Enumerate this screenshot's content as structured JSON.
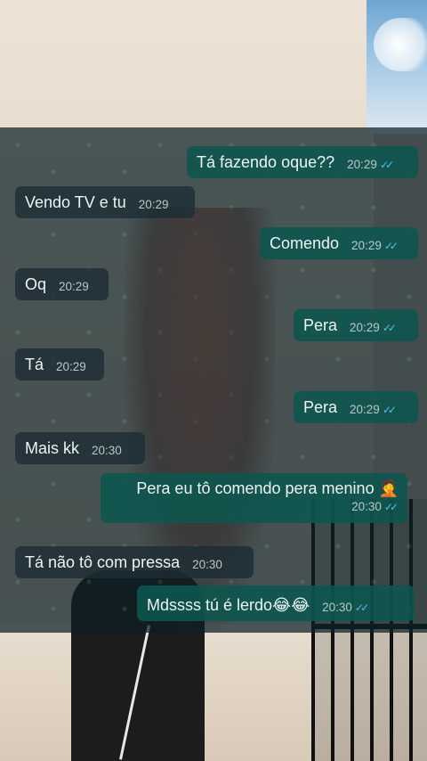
{
  "messages": [
    {
      "side": "out",
      "text": "Tá fazendo oque??",
      "time": "20:29",
      "ticks": "✓✓"
    },
    {
      "side": "in",
      "text": "Vendo TV e tu",
      "time": "20:29"
    },
    {
      "side": "out",
      "text": "Comendo",
      "time": "20:29",
      "ticks": "✓✓"
    },
    {
      "side": "in",
      "text": "Oq",
      "time": "20:29"
    },
    {
      "side": "out",
      "text": "Pera",
      "time": "20:29",
      "ticks": "✓✓"
    },
    {
      "side": "in",
      "text": "Tá",
      "time": "20:29"
    },
    {
      "side": "out",
      "text": "Pera",
      "time": "20:29",
      "ticks": "✓✓"
    },
    {
      "side": "in",
      "text": "Mais kk",
      "time": "20:30"
    },
    {
      "side": "out",
      "text": "Pera eu tô comendo pera menino 🤦",
      "time": "20:30",
      "ticks": "✓✓"
    },
    {
      "side": "in",
      "text": "Tá não tô com pressa",
      "time": "20:30"
    },
    {
      "side": "out",
      "text": "Mdssss tú é lerdo😂😂",
      "time": "20:30",
      "ticks": "✓✓"
    }
  ],
  "colors": {
    "outgoing_bubble": "#0d564e",
    "incoming_bubble": "#1c2d34",
    "read_ticks": "#53bdeb"
  }
}
